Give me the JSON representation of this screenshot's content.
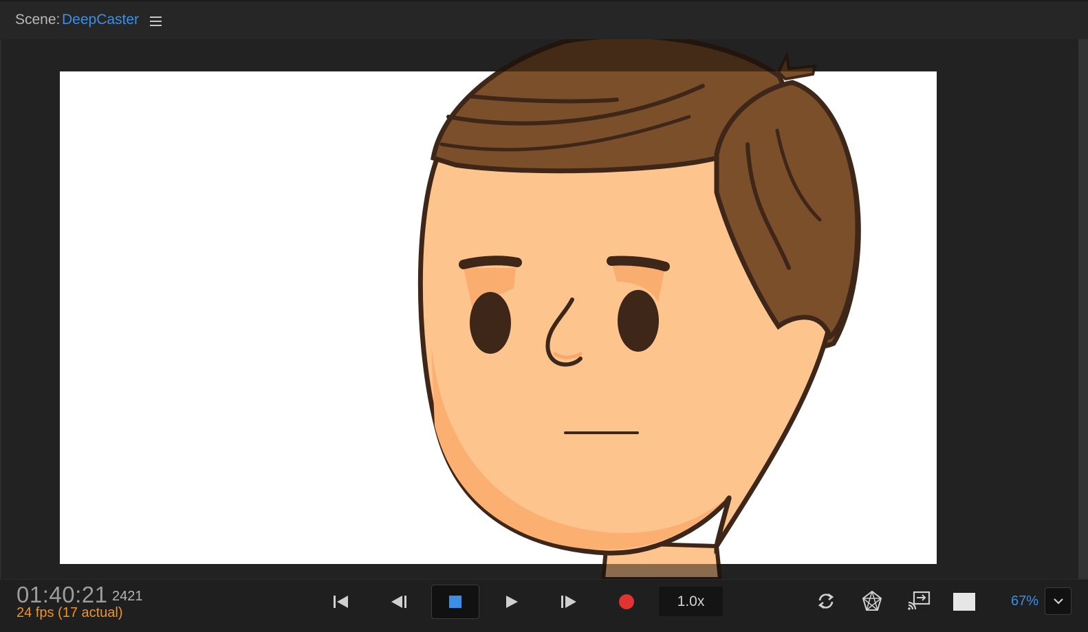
{
  "scene": {
    "label": "Scene:",
    "name": "DeepCaster"
  },
  "icons": {
    "menu": "hamburger-menu-icon",
    "first": "skip-to-start-icon",
    "prev": "step-back-icon",
    "stop": "stop-icon",
    "play": "play-icon",
    "next": "step-forward-icon",
    "record": "record-icon",
    "loop": "loop-icon",
    "mesh": "mesh-icon",
    "cast": "cast-icon",
    "background": "background-color-icon",
    "dropdown": "chevron-down-icon"
  },
  "transport": {
    "timecode": "01:40:21",
    "frame": "2421",
    "fps": "24 fps (17 actual)",
    "speed": "1.0x",
    "zoom": "67%"
  },
  "colors": {
    "accent": "#3b8fe6",
    "warning": "#f0961e",
    "record": "#e23232",
    "stop": "#3b8fe6"
  }
}
